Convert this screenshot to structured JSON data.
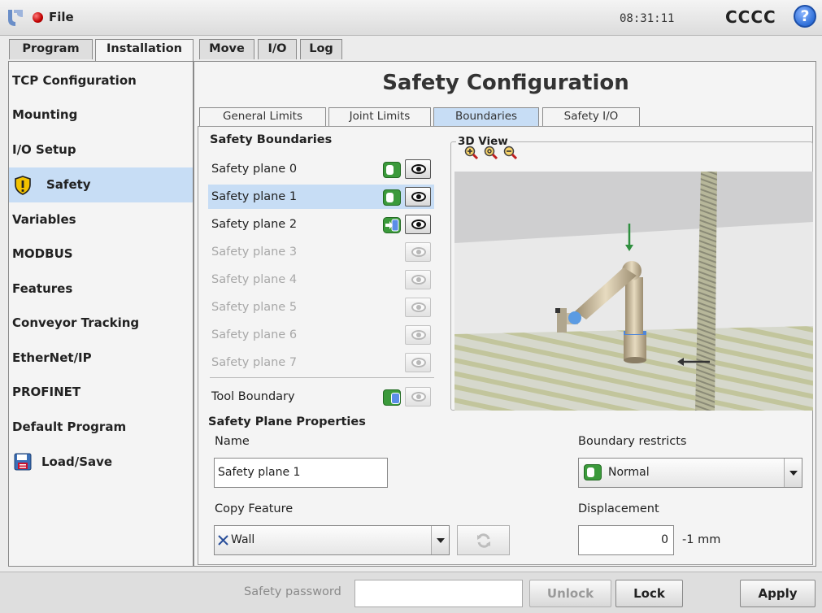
{
  "topbar": {
    "file_label": "File",
    "clock": "08:31:11",
    "robot_name": "CCCC",
    "help_label": "?"
  },
  "main_tabs": [
    {
      "label": "Program",
      "active": false
    },
    {
      "label": "Installation",
      "active": true
    },
    {
      "label": "Move",
      "active": false
    },
    {
      "label": "I/O",
      "active": false
    },
    {
      "label": "Log",
      "active": false
    }
  ],
  "sidebar": {
    "items": [
      {
        "label": "TCP Configuration"
      },
      {
        "label": "Mounting"
      },
      {
        "label": "I/O Setup"
      },
      {
        "label": "Safety",
        "selected": true,
        "icon": "warning-shield-icon"
      },
      {
        "label": "Variables"
      },
      {
        "label": "MODBUS"
      },
      {
        "label": "Features"
      },
      {
        "label": "Conveyor Tracking"
      },
      {
        "label": "EtherNet/IP"
      },
      {
        "label": "PROFINET"
      },
      {
        "label": "Default Program"
      },
      {
        "label": "Load/Save",
        "icon": "floppy-disk-icon"
      }
    ]
  },
  "page_title": "Safety Configuration",
  "sub_tabs": [
    {
      "label": "General Limits",
      "active": false
    },
    {
      "label": "Joint Limits",
      "active": false
    },
    {
      "label": "Boundaries",
      "active": true
    },
    {
      "label": "Safety I/O",
      "active": false
    }
  ],
  "boundaries": {
    "title": "Safety Boundaries",
    "planes": [
      {
        "label": "Safety plane 0",
        "mode": "normal",
        "visible": true,
        "enabled": true
      },
      {
        "label": "Safety plane 1",
        "mode": "normal",
        "visible": true,
        "enabled": true,
        "selected": true
      },
      {
        "label": "Safety plane 2",
        "mode": "trigger-reduced",
        "visible": true,
        "enabled": true
      },
      {
        "label": "Safety plane 3",
        "mode": "disabled",
        "visible": false,
        "enabled": false
      },
      {
        "label": "Safety plane 4",
        "mode": "disabled",
        "visible": false,
        "enabled": false
      },
      {
        "label": "Safety plane 5",
        "mode": "disabled",
        "visible": false,
        "enabled": false
      },
      {
        "label": "Safety plane 6",
        "mode": "disabled",
        "visible": false,
        "enabled": false
      },
      {
        "label": "Safety plane 7",
        "mode": "disabled",
        "visible": false,
        "enabled": false
      }
    ],
    "tool_boundary": {
      "label": "Tool Boundary",
      "mode": "tool",
      "visible": false
    }
  },
  "view3d": {
    "title": "3D View",
    "zoom_icons": [
      "zoom-in-icon",
      "zoom-reset-icon",
      "zoom-out-icon"
    ]
  },
  "properties": {
    "title": "Safety Plane Properties",
    "name_label": "Name",
    "name_value": "Safety plane 1",
    "boundary_label": "Boundary restricts",
    "boundary_value": "Normal",
    "copy_feature_label": "Copy Feature",
    "copy_feature_value": "Wall",
    "displacement_label": "Displacement",
    "displacement_value": "0",
    "displacement_unit": "-1 mm"
  },
  "bottombar": {
    "password_label": "Safety password",
    "unlock_label": "Unlock",
    "lock_label": "Lock",
    "apply_label": "Apply"
  },
  "colors": {
    "selection": "#c7ddf5",
    "normal_mode": "#3b9a3b",
    "status_dot": "#c00000",
    "help": "#2f6fd8"
  }
}
